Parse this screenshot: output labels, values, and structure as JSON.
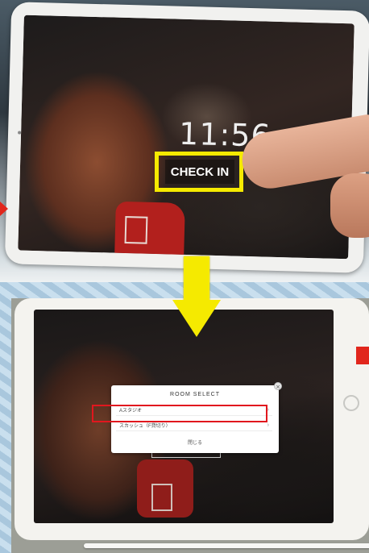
{
  "top": {
    "clock": "11:56",
    "checkin_label": "CHECK IN"
  },
  "bottom": {
    "modal": {
      "title": "ROOM SELECT",
      "rooms": [
        {
          "label": "Aスタジオ"
        },
        {
          "label": "スカッシュ（F貸切り）"
        }
      ],
      "close_label": "閉じる"
    },
    "behind_button_label": "CHECK IN"
  },
  "colors": {
    "highlight_yellow": "#f5ea00",
    "highlight_red": "#e1171e",
    "glove_red": "#b2201d"
  },
  "icons": [
    "down-arrow-icon",
    "close-icon",
    "chevron-right-icon",
    "home-button-icon"
  ]
}
